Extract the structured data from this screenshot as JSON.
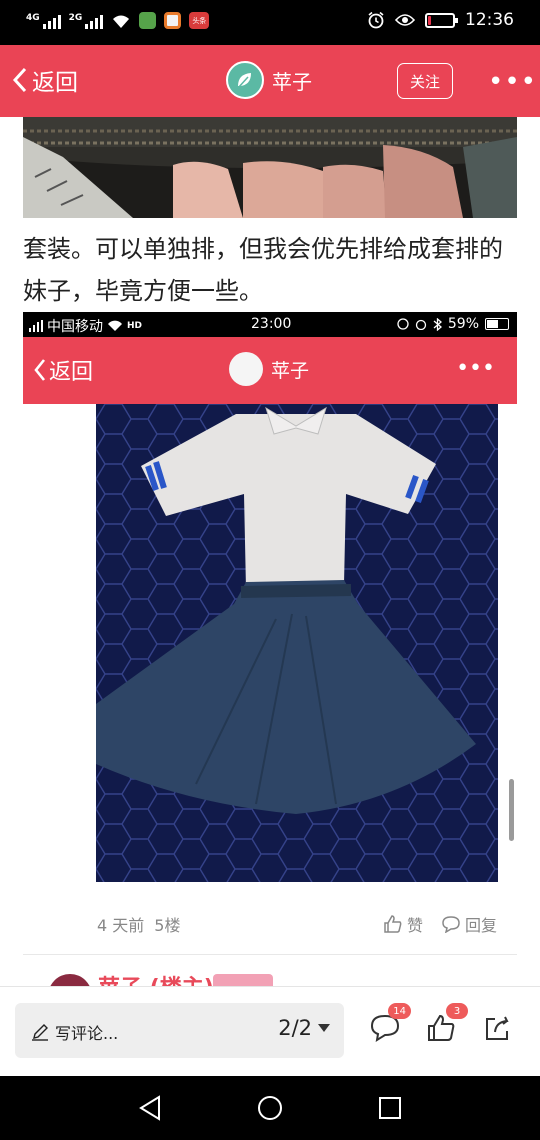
{
  "status_bar": {
    "net1": "4G",
    "net2": "2G",
    "time": "12:36",
    "battery_level": 0.12,
    "app_icons": [
      "green-app-icon",
      "orange-app-icon",
      "toutiao-icon"
    ],
    "toutiao_label": "头条"
  },
  "header": {
    "back_label": "返回",
    "title": "苹子",
    "follow_label": "关注",
    "more_label": "•••"
  },
  "post": {
    "text": "套装。可以单独排，但我会优先排给成套排的妹子，毕竟方便一些。"
  },
  "embedded_screenshot": {
    "carrier": "中国移动",
    "hd_label": "HD",
    "time": "23:00",
    "battery_text": "59%",
    "battery_level": 0.59,
    "back_label": "返回",
    "title": "苹子",
    "more_label": "•••"
  },
  "post_meta": {
    "time_ago": "4 天前",
    "floor": "5楼",
    "like_label": "赞",
    "reply_label": "回复"
  },
  "next_reply": {
    "author": "苹子 (楼主)"
  },
  "bottom_bar": {
    "compose_placeholder": "写评论...",
    "page_indicator": "2/2",
    "comments_count": "14",
    "likes_count": "3"
  },
  "colors": {
    "brand_red": "#ea4455",
    "avatar_teal": "#5bb9a4"
  }
}
